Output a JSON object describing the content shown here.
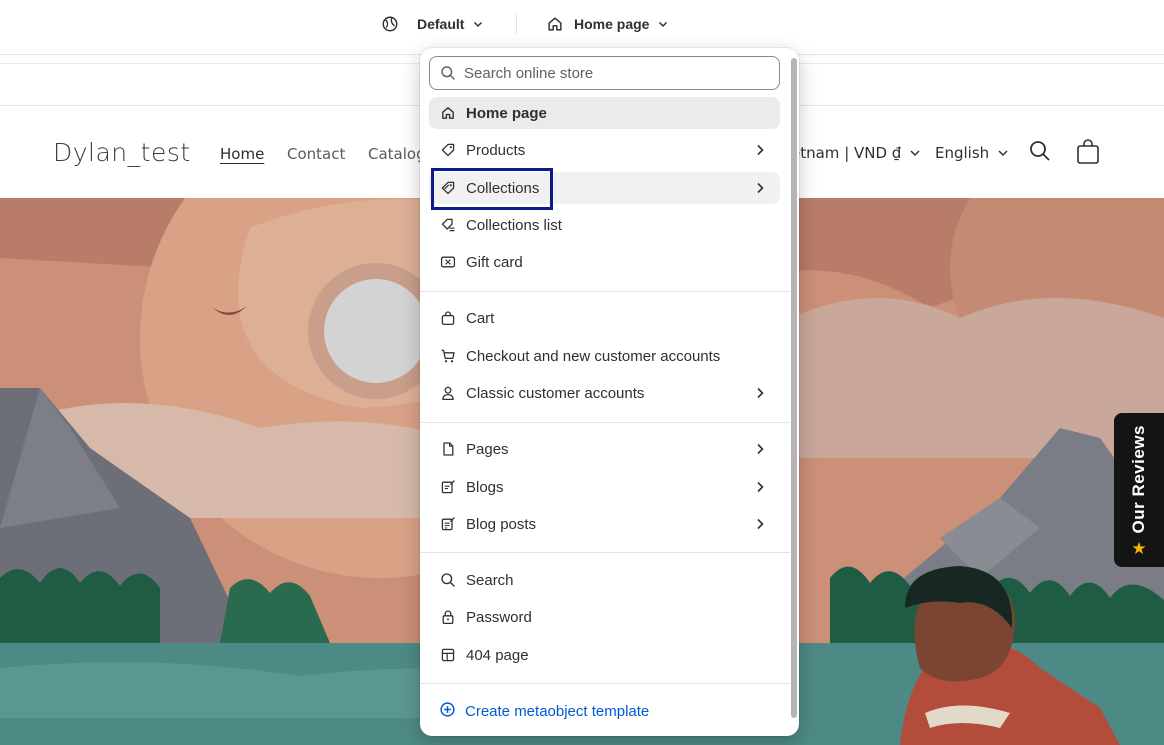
{
  "topbar": {
    "theme_label": "Default",
    "page_label": "Home page"
  },
  "store": {
    "logo": "Dylan_test",
    "nav": [
      "Home",
      "Contact",
      "Catalog"
    ],
    "country": "etnam | VND ₫",
    "language": "English"
  },
  "reviews_tab": {
    "label": "Our Reviews"
  },
  "menu": {
    "search_placeholder": "Search online store",
    "groups": [
      [
        {
          "label": "Home page",
          "icon": "home-icon",
          "chevron": false
        },
        {
          "label": "Products",
          "icon": "tag-icon",
          "chevron": true
        },
        {
          "label": "Collections",
          "icon": "collection-tag-icon",
          "chevron": true
        },
        {
          "label": "Collections list",
          "icon": "collections-list-icon",
          "chevron": false
        },
        {
          "label": "Gift card",
          "icon": "gift-card-icon",
          "chevron": false
        }
      ],
      [
        {
          "label": "Cart",
          "icon": "bag-icon",
          "chevron": false
        },
        {
          "label": "Checkout and new customer accounts",
          "icon": "cart-icon",
          "chevron": false
        },
        {
          "label": "Classic customer accounts",
          "icon": "person-icon",
          "chevron": true
        }
      ],
      [
        {
          "label": "Pages",
          "icon": "page-icon",
          "chevron": true
        },
        {
          "label": "Blogs",
          "icon": "blog-icon",
          "chevron": true
        },
        {
          "label": "Blog posts",
          "icon": "blog-post-icon",
          "chevron": true
        }
      ],
      [
        {
          "label": "Search",
          "icon": "search-icon",
          "chevron": false
        },
        {
          "label": "Password",
          "icon": "lock-icon",
          "chevron": false
        },
        {
          "label": "404 page",
          "icon": "layout-icon",
          "chevron": false
        }
      ]
    ],
    "create_label": "Create metaobject template"
  },
  "colors": {
    "accent": "#005bd3",
    "focus_outline": "#0a1c8a",
    "highlight_bg": "#ebebeb"
  }
}
